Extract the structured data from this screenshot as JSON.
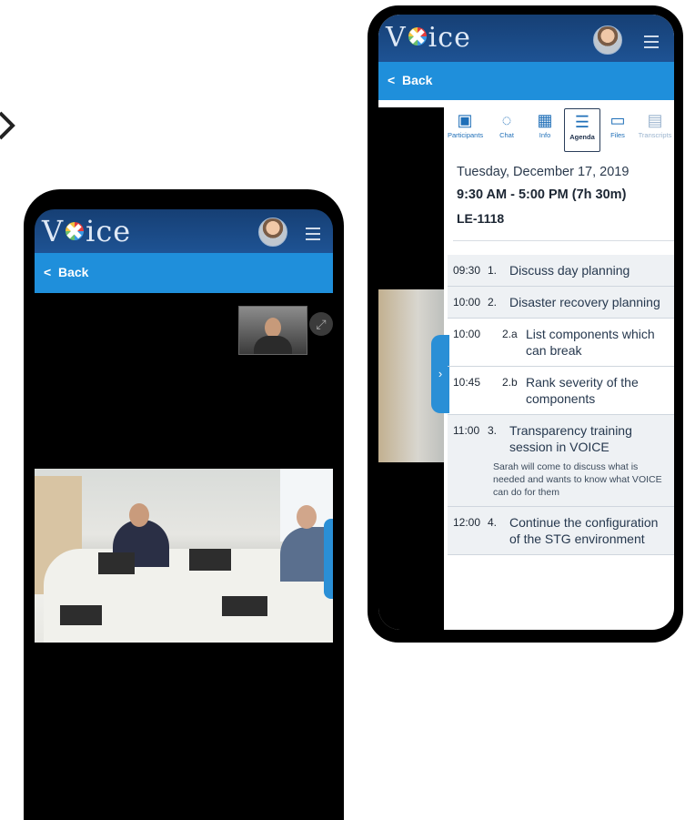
{
  "app_name": "Voice",
  "left_phone": {
    "logo_text_v": "V",
    "logo_text_ice": "ice",
    "back_label": "Back",
    "expand_icon": "expand-icon"
  },
  "right_phone": {
    "logo_text_v": "V",
    "logo_text_ice": "ice",
    "back_label": "Back",
    "tabs": [
      {
        "label": "Participants",
        "icon": "participants-icon",
        "glyph": "▣"
      },
      {
        "label": "Chat",
        "icon": "chat-icon",
        "glyph": "◌"
      },
      {
        "label": "Info",
        "icon": "calendar-icon",
        "glyph": "▦"
      },
      {
        "label": "Agenda",
        "icon": "list-icon",
        "glyph": "☰",
        "active": true
      },
      {
        "label": "Files",
        "icon": "folder-icon",
        "glyph": "▭"
      },
      {
        "label": "Transcripts",
        "icon": "book-icon",
        "glyph": "▤",
        "disabled": true
      }
    ],
    "meeting": {
      "date": "Tuesday, December 17, 2019",
      "time": "9:30 AM - 5:00 PM (7h 30m)",
      "room": "LE-1118"
    },
    "agenda": [
      {
        "time": "09:30",
        "num": "1.",
        "title": "Discuss day planning",
        "shade": true
      },
      {
        "time": "10:00",
        "num": "2.",
        "title": "Disaster recovery planning",
        "shade": true
      },
      {
        "time": "10:00",
        "num": "2.a",
        "title": "List components which can break",
        "sub": true
      },
      {
        "time": "10:45",
        "num": "2.b",
        "title": "Rank severity of the components",
        "sub": true
      },
      {
        "time": "11:00",
        "num": "3.",
        "title": "Transparency training session in VOICE",
        "shade": true,
        "desc": "Sarah will come to discuss what is needed and wants to know what VOICE can do for them"
      },
      {
        "time": "12:00",
        "num": "4.",
        "title": "Continue the configuration of the STG environment",
        "shade": true
      }
    ]
  },
  "colors": {
    "header": "#1e5394",
    "backbar": "#1f8fdb",
    "accent": "#1f6fb8"
  }
}
